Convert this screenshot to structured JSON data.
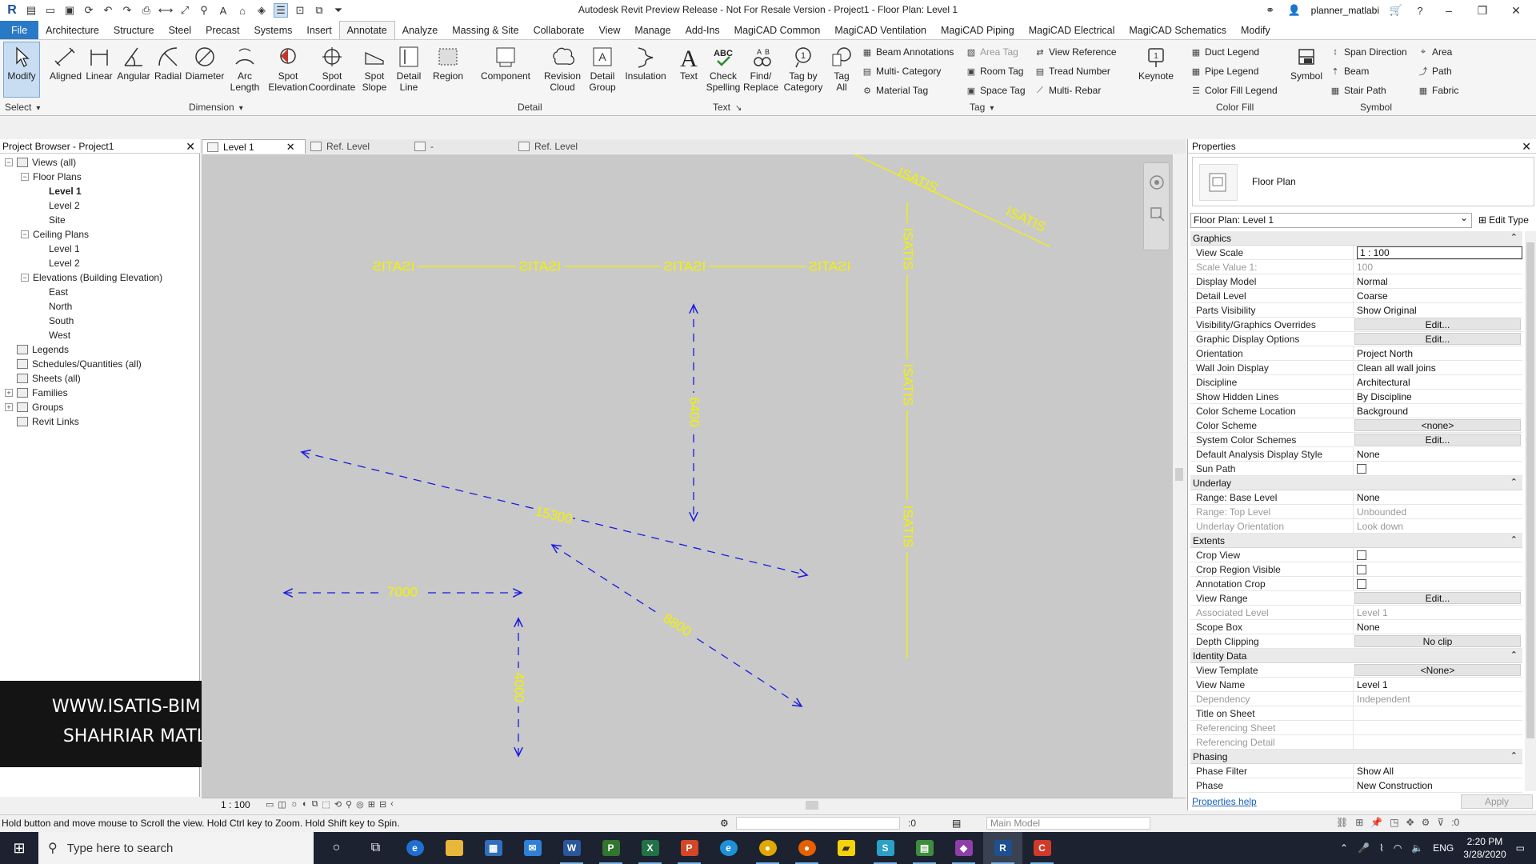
{
  "window": {
    "title": "Autodesk Revit Preview Release - Not For Resale Version - Project1 - Floor Plan: Level 1",
    "user": "planner_matlabi"
  },
  "ribbon_tabs": [
    "File",
    "Architecture",
    "Structure",
    "Steel",
    "Precast",
    "Systems",
    "Insert",
    "Annotate",
    "Analyze",
    "Massing & Site",
    "Collaborate",
    "View",
    "Manage",
    "Add-Ins",
    "MagiCAD Common",
    "MagiCAD Ventilation",
    "MagiCAD Piping",
    "MagiCAD Electrical",
    "MagiCAD Schematics",
    "Modify"
  ],
  "active_tab": "Annotate",
  "ribbon": {
    "modify": "Modify",
    "select": "Select",
    "dimension_tools": [
      "Aligned",
      "Linear",
      "Angular",
      "Radial",
      "Diameter",
      "Arc\nLength",
      "Spot\nElevation",
      "Spot\nCoordinate",
      "Spot\nSlope"
    ],
    "detail_tools": [
      "Detail\nLine",
      "Region",
      "Component",
      "Revision\nCloud",
      "Detail\nGroup",
      "Insulation"
    ],
    "text_tools": [
      "Text",
      "Check\nSpelling",
      "Find/\nReplace"
    ],
    "tag_tools": [
      "Tag by\nCategory",
      "Tag\nAll"
    ],
    "tag_small": [
      "Beam  Annotations",
      "Multi-  Category",
      "Material  Tag",
      "Area  Tag",
      "Room  Tag",
      "Space  Tag",
      "View  Reference",
      "Tread  Number",
      "Multi-  Rebar"
    ],
    "keynote": "Keynote",
    "color_fill_small": [
      "Duct  Legend",
      "Pipe  Legend",
      "Color Fill  Legend"
    ],
    "symbol": "Symbol",
    "symbol_small": [
      "Span  Direction",
      "Beam",
      "Stair  Path",
      "Area",
      "Path",
      "Fabric"
    ],
    "panels": [
      "Select",
      "Dimension",
      "Detail",
      "Text",
      "Tag",
      "Color Fill",
      "Symbol"
    ]
  },
  "project_browser": {
    "title": "Project Browser - Project1",
    "items": [
      {
        "label": "Views (all)",
        "level": 0,
        "toggle": "−"
      },
      {
        "label": "Floor Plans",
        "level": 1,
        "toggle": "−"
      },
      {
        "label": "Level 1",
        "level": 2,
        "bold": true
      },
      {
        "label": "Level 2",
        "level": 2
      },
      {
        "label": "Site",
        "level": 2
      },
      {
        "label": "Ceiling Plans",
        "level": 1,
        "toggle": "−"
      },
      {
        "label": "Level 1",
        "level": 2
      },
      {
        "label": "Level 2",
        "level": 2
      },
      {
        "label": "Elevations (Building Elevation)",
        "level": 1,
        "toggle": "−"
      },
      {
        "label": "East",
        "level": 2
      },
      {
        "label": "North",
        "level": 2
      },
      {
        "label": "South",
        "level": 2
      },
      {
        "label": "West",
        "level": 2
      },
      {
        "label": "Legends",
        "level": 0,
        "icon": true
      },
      {
        "label": "Schedules/Quantities (all)",
        "level": 0,
        "icon": true
      },
      {
        "label": "Sheets (all)",
        "level": 0,
        "icon": true
      },
      {
        "label": "Families",
        "level": 0,
        "toggle": "+"
      },
      {
        "label": "Groups",
        "level": 0,
        "toggle": "+"
      },
      {
        "label": "Revit Links",
        "level": 0,
        "icon": true
      }
    ]
  },
  "watermark": {
    "line1": "WWW.ISATIS-BIM.COM",
    "line2": "SHAHRIAR MATLABI"
  },
  "view_tabs": [
    "Level 1",
    "Ref. Level",
    "-",
    "Ref. Level"
  ],
  "canvas": {
    "text_color": "#f2f200",
    "dim_color": "#1a1ae0",
    "labels": {
      "isatis": "ISATIS",
      "d1": "6400",
      "d2": "15300",
      "d3": "7000",
      "d4": "8800",
      "d5": "4000"
    }
  },
  "view_control": {
    "scale": "1 : 100"
  },
  "properties": {
    "title": "Properties",
    "type_name": "Floor Plan",
    "instance": "Floor Plan: Level 1",
    "edit_type": "Edit Type",
    "groups": [
      {
        "name": "Graphics",
        "rows": [
          {
            "k": "View Scale",
            "v": "1 : 100",
            "style": "boxed"
          },
          {
            "k": "Scale Value    1:",
            "v": "100",
            "ro": true
          },
          {
            "k": "Display Model",
            "v": "Normal"
          },
          {
            "k": "Detail Level",
            "v": "Coarse"
          },
          {
            "k": "Parts Visibility",
            "v": "Show Original"
          },
          {
            "k": "Visibility/Graphics Overrides",
            "v": "Edit...",
            "style": "btn"
          },
          {
            "k": "Graphic Display Options",
            "v": "Edit...",
            "style": "btn"
          },
          {
            "k": "Orientation",
            "v": "Project North"
          },
          {
            "k": "Wall Join Display",
            "v": "Clean all wall joins"
          },
          {
            "k": "Discipline",
            "v": "Architectural"
          },
          {
            "k": "Show Hidden Lines",
            "v": "By Discipline"
          },
          {
            "k": "Color Scheme Location",
            "v": "Background"
          },
          {
            "k": "Color Scheme",
            "v": "<none>",
            "style": "btn"
          },
          {
            "k": "System Color Schemes",
            "v": "Edit...",
            "style": "btn"
          },
          {
            "k": "Default Analysis Display Style",
            "v": "None"
          },
          {
            "k": "Sun Path",
            "v": "",
            "style": "check"
          }
        ]
      },
      {
        "name": "Underlay",
        "rows": [
          {
            "k": "Range: Base Level",
            "v": "None"
          },
          {
            "k": "Range: Top Level",
            "v": "Unbounded",
            "ro": true
          },
          {
            "k": "Underlay Orientation",
            "v": "Look down",
            "ro": true
          }
        ]
      },
      {
        "name": "Extents",
        "rows": [
          {
            "k": "Crop View",
            "v": "",
            "style": "check"
          },
          {
            "k": "Crop Region Visible",
            "v": "",
            "style": "check"
          },
          {
            "k": "Annotation Crop",
            "v": "",
            "style": "check"
          },
          {
            "k": "View Range",
            "v": "Edit...",
            "style": "btn"
          },
          {
            "k": "Associated Level",
            "v": "Level 1",
            "ro": true
          },
          {
            "k": "Scope Box",
            "v": "None"
          },
          {
            "k": "Depth Clipping",
            "v": "No clip",
            "style": "btn"
          }
        ]
      },
      {
        "name": "Identity Data",
        "rows": [
          {
            "k": "View Template",
            "v": "<None>",
            "style": "btn"
          },
          {
            "k": "View Name",
            "v": "Level 1"
          },
          {
            "k": "Dependency",
            "v": "Independent",
            "ro": true
          },
          {
            "k": "Title on Sheet",
            "v": ""
          },
          {
            "k": "Referencing Sheet",
            "v": "",
            "ro": true
          },
          {
            "k": "Referencing Detail",
            "v": "",
            "ro": true
          }
        ]
      },
      {
        "name": "Phasing",
        "rows": [
          {
            "k": "Phase Filter",
            "v": "Show All"
          },
          {
            "k": "Phase",
            "v": "New Construction"
          }
        ]
      }
    ],
    "help": "Properties help",
    "apply": "Apply"
  },
  "status": {
    "hint": "Hold button and move mouse to Scroll the view. Hold Ctrl key to Zoom. Hold Shift key to Spin.",
    "selection_count": ":0",
    "model": "Main Model",
    "filter_count": ":0"
  },
  "taskbar": {
    "search_placeholder": "Type here to search",
    "language": "ENG",
    "time": "2:20 PM",
    "date": "3/28/2020"
  }
}
